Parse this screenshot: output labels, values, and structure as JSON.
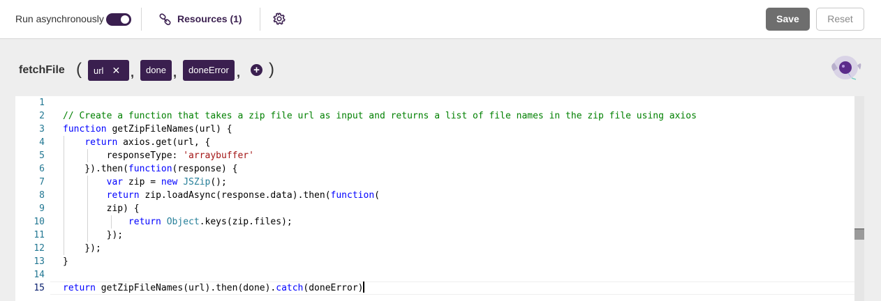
{
  "toolbar": {
    "async_label": "Run asynchronously",
    "async_enabled": true,
    "resources_label": "Resources (1)",
    "resources_icon": "link-icon",
    "settings_icon": "gear-icon",
    "save_label": "Save",
    "reset_label": "Reset"
  },
  "signature": {
    "function_name": "fetchFile",
    "open_paren": "(",
    "close_paren": ")",
    "params": [
      "url",
      "done",
      "doneError"
    ],
    "remove_icon": "close-icon",
    "add_param_icon": "plus-icon"
  },
  "editor": {
    "line_numbers": [
      "1",
      "2",
      "3",
      "4",
      "5",
      "6",
      "7",
      "8",
      "9",
      "10",
      "11",
      "12",
      "13",
      "14",
      "15"
    ],
    "active_line": "15",
    "lines": [
      "",
      "// Create a function that takes a zip file url as input and returns a list of file names in the zip file using axios",
      "function getZipFileNames(url) {",
      "    return axios.get(url, {",
      "        responseType: 'arraybuffer'",
      "    }).then(function(response) {",
      "        var zip = new JSZip();",
      "        return zip.loadAsync(response.data).then(function(",
      "        zip) {",
      "            return Object.keys(zip.files);",
      "        });",
      "    });",
      "}",
      "",
      "return getZipFileNames(url).then(done).catch(doneError)"
    ]
  },
  "colors": {
    "accent": "#3a1f4f",
    "save_bg": "#6e6e6e",
    "comment": "#008000",
    "keyword": "#0000ff",
    "string": "#a31515",
    "type": "#267f99"
  }
}
